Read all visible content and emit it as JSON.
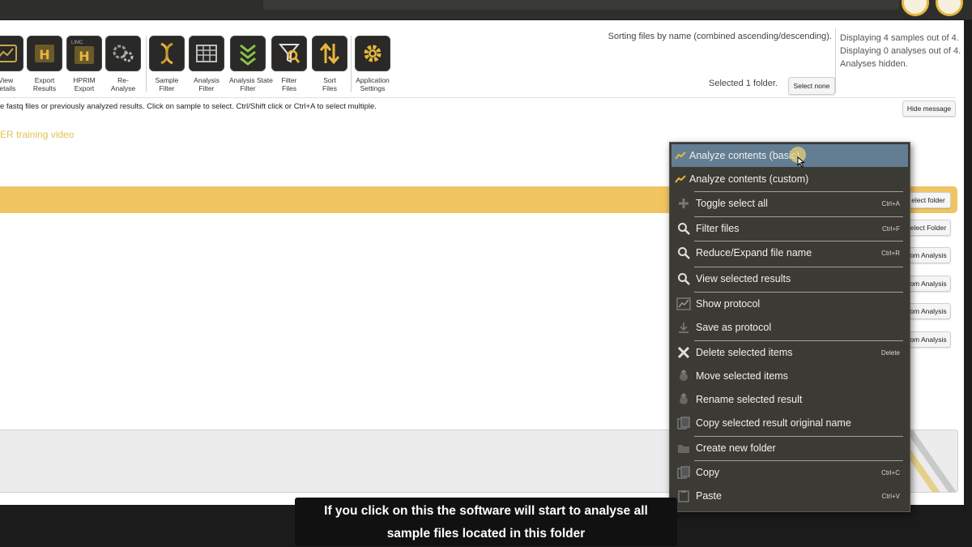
{
  "toolbar": {
    "items": [
      {
        "label": "View\ndetails",
        "icon": "view-details-icon"
      },
      {
        "label": "Export\nResults",
        "icon": "export-results-icon"
      },
      {
        "label": "HPRIM\nExport",
        "icon": "hprim-export-icon",
        "badge": "LIMC"
      },
      {
        "label": "Re-\nAnalyse",
        "icon": "reanalyse-icon"
      },
      {
        "label": "Sample\nFilter",
        "icon": "sample-filter-icon"
      },
      {
        "label": "Analysis\nFilter",
        "icon": "analysis-filter-icon"
      },
      {
        "label": "Analysis State\nFilter",
        "icon": "analysis-state-filter-icon"
      },
      {
        "label": "Filter\nFiles",
        "icon": "filter-files-icon"
      },
      {
        "label": "Sort\nFiles",
        "icon": "sort-files-icon"
      },
      {
        "label": "Application\nSettings",
        "icon": "application-settings-icon"
      }
    ]
  },
  "status": {
    "sorting": "Sorting files by name (combined ascending/descending).",
    "selected": "Selected 1 folder.",
    "select_none": "Select none",
    "displaying_samples": "Displaying 4 samples out of 4.",
    "displaying_analyses": "Displaying 0 analyses out of 4.",
    "analyses_hidden": "Analyses hidden."
  },
  "message": {
    "text": "e fastq files or previously analyzed results. Click on sample to select. Ctrl/Shift click or Ctrl+A to select multiple.",
    "hide": "Hide message",
    "video_link": "ER training video"
  },
  "rows": {
    "buttons": [
      "elect folder",
      "elect Folder",
      "om Analysis",
      "om Analysis",
      "om Analysis",
      "om Analysis"
    ]
  },
  "context_menu": {
    "items": [
      {
        "label": "Analyze contents (basic)",
        "shortcut": "",
        "icon": "analyze-basic-icon",
        "highlighted": true
      },
      {
        "label": "Analyze contents (custom)",
        "shortcut": "",
        "icon": "analyze-custom-icon"
      },
      {
        "label": "Toggle select all",
        "shortcut": "Ctrl+A",
        "icon": "toggle-select-icon"
      },
      {
        "label": "Filter files",
        "shortcut": "Ctrl+F",
        "icon": "search-icon"
      },
      {
        "label": "Reduce/Expand file name",
        "shortcut": "Ctrl+R",
        "icon": "search-icon"
      },
      {
        "label": "View selected results",
        "shortcut": "",
        "icon": "search-icon"
      },
      {
        "label": "Show protocol",
        "shortcut": "",
        "icon": "protocol-icon"
      },
      {
        "label": "Save as protocol",
        "shortcut": "",
        "icon": "save-icon"
      },
      {
        "label": "Delete selected items",
        "shortcut": "Delete",
        "icon": "delete-icon"
      },
      {
        "label": "Move selected items",
        "shortcut": "",
        "icon": "move-icon"
      },
      {
        "label": "Rename selected result",
        "shortcut": "",
        "icon": "rename-icon"
      },
      {
        "label": "Copy selected result original name",
        "shortcut": "",
        "icon": "copy-name-icon"
      },
      {
        "label": "Create new folder",
        "shortcut": "",
        "icon": "folder-icon"
      },
      {
        "label": "Copy",
        "shortcut": "Ctrl+C",
        "icon": "copy-icon"
      },
      {
        "label": "Paste",
        "shortcut": "Ctrl+V",
        "icon": "paste-icon"
      }
    ]
  },
  "caption": {
    "line1": "If you click on this the software will start to analyse all",
    "line2": "sample files located in this folder"
  },
  "colors": {
    "accent": "#f1c462",
    "icon_gold": "#e7b73c",
    "menu_bg": "#3b3a34",
    "menu_highlight": "#637d93",
    "link": "#e2c354"
  }
}
